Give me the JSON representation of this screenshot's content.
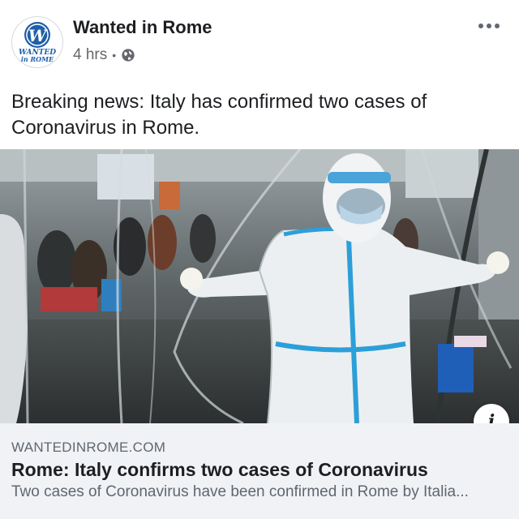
{
  "post": {
    "page_name": "Wanted in Rome",
    "logo_letter": "W",
    "logo_text_line1": "WANTED",
    "logo_text_line2": "in ROME",
    "time": "4 hrs",
    "separator": "•",
    "privacy_icon": "globe-icon",
    "more_icon": "more-options-icon",
    "text": "Breaking news: Italy has confirmed two cases of Coronavirus in Rome."
  },
  "link_preview": {
    "domain": "WANTEDINROME.COM",
    "headline": "Rome: Italy confirms two cases of Coronavirus",
    "description": "Two cases of Coronavirus have been confirmed in Rome by Italia...",
    "info_icon_glyph": "i"
  },
  "colors": {
    "logo_blue": "#1f5fa8",
    "preview_background": "#f0f2f5",
    "secondary_text": "#65676b"
  }
}
